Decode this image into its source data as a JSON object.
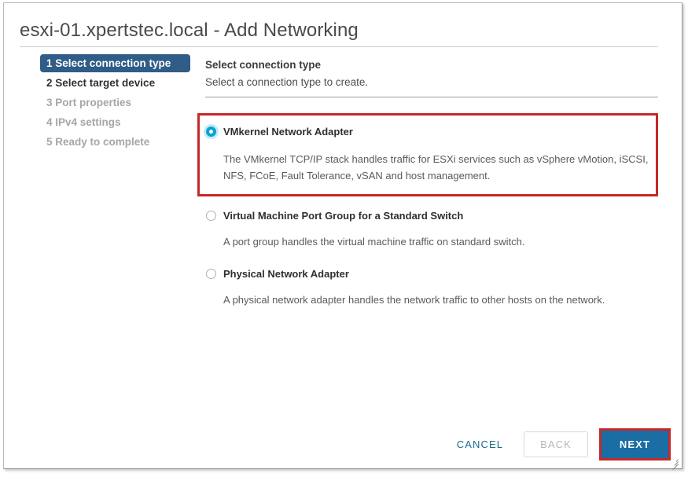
{
  "window": {
    "title": "esxi-01.xpertstec.local - Add Networking",
    "accent_blue": "#1a6ea3",
    "highlight_red": "#c62828",
    "active_step_blue": "#2f5d87",
    "radio_selected_blue": "#0aa3d8"
  },
  "wizard_steps": [
    {
      "label": "1 Select connection type",
      "state": "active"
    },
    {
      "label": "2 Select target device",
      "state": "enabled"
    },
    {
      "label": "3 Port properties",
      "state": "disabled"
    },
    {
      "label": "4 IPv4 settings",
      "state": "disabled"
    },
    {
      "label": "5 Ready to complete",
      "state": "disabled"
    }
  ],
  "content": {
    "heading": "Select connection type",
    "subheading": "Select a connection type to create."
  },
  "options": [
    {
      "label": "VMkernel Network Adapter",
      "description": "The VMkernel TCP/IP stack handles traffic for ESXi services such as vSphere vMotion, iSCSI, NFS, FCoE, Fault Tolerance, vSAN and host management.",
      "selected": true,
      "highlighted": true
    },
    {
      "label": "Virtual Machine Port Group for a Standard Switch",
      "description": "A port group handles the virtual machine traffic on standard switch.",
      "selected": false,
      "highlighted": false
    },
    {
      "label": "Physical Network Adapter",
      "description": "A physical network adapter handles the network traffic to other hosts on the network.",
      "selected": false,
      "highlighted": false
    }
  ],
  "footer": {
    "cancel_label": "CANCEL",
    "back_label": "BACK",
    "back_disabled": true,
    "next_label": "NEXT",
    "next_highlighted": true
  }
}
